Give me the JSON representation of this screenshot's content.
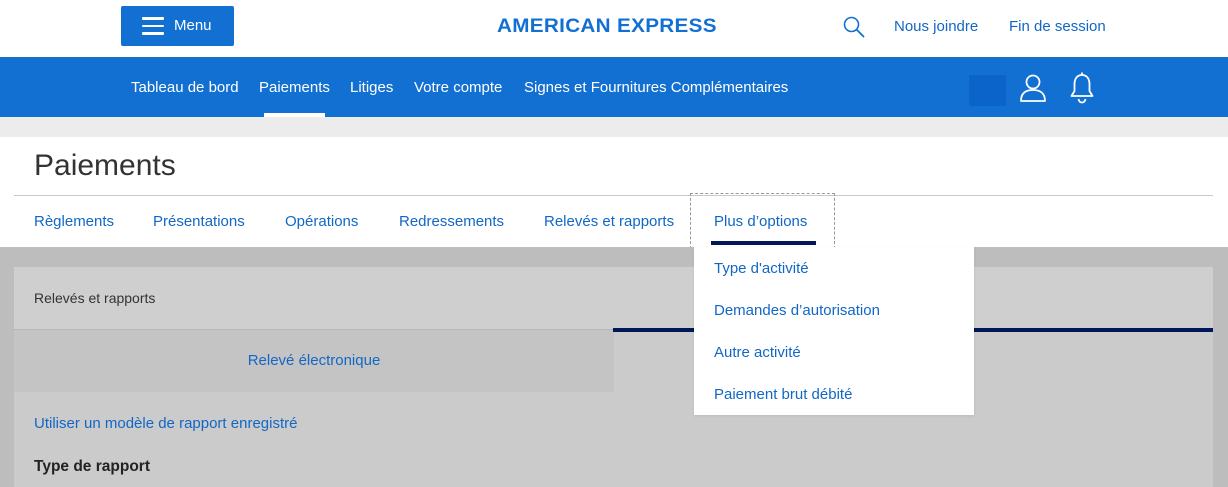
{
  "header": {
    "menu_label": "Menu",
    "logo_text": "AMERICAN EXPRESS",
    "contact_label": "Nous joindre",
    "logout_label": "Fin de session"
  },
  "main_nav": {
    "items": [
      {
        "label": "Tableau de bord"
      },
      {
        "label": "Paiements",
        "active": true
      },
      {
        "label": "Litiges"
      },
      {
        "label": "Votre compte"
      },
      {
        "label": "Signes et Fournitures Complémentaires"
      }
    ]
  },
  "page": {
    "title": "Paiements",
    "subtabs": [
      {
        "label": "Règlements"
      },
      {
        "label": "Présentations"
      },
      {
        "label": "Opérations"
      },
      {
        "label": "Redressements"
      },
      {
        "label": "Relevés et rapports"
      },
      {
        "label": "Plus d’options",
        "active": true
      }
    ]
  },
  "dropdown": {
    "items": [
      {
        "label": "Type d'activité"
      },
      {
        "label": "Demandes d’autorisation"
      },
      {
        "label": "Autre activité"
      },
      {
        "label": "Paiement brut débité"
      }
    ]
  },
  "panel": {
    "heading": "Relevés et rapports",
    "tab_left": "Relevé électronique",
    "saved_template_link": "Utiliser un modèle de rapport enregistré",
    "report_type_label": "Type de rapport"
  },
  "colors": {
    "brand_blue": "#1270d2",
    "link_blue": "#1267c6",
    "navy": "#00175a"
  },
  "icons": {
    "menu": "hamburger-icon",
    "search": "search-icon",
    "user": "user-icon",
    "notifications": "bell-icon"
  }
}
